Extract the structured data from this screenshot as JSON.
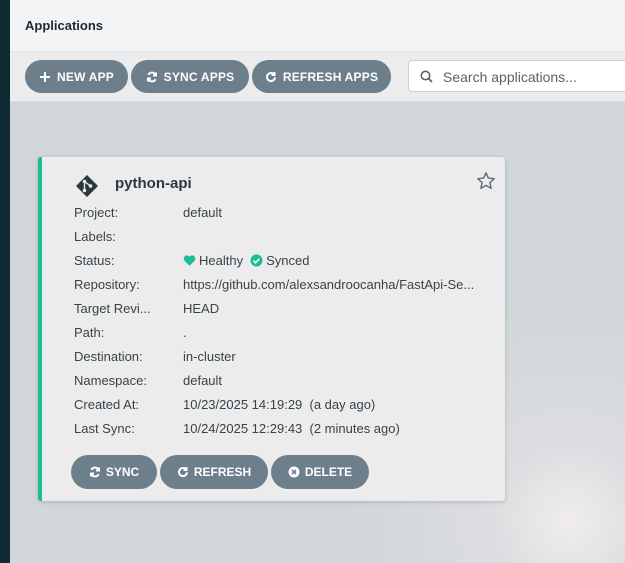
{
  "header": {
    "title": "Applications"
  },
  "toolbar": {
    "new_app": "NEW APP",
    "sync_apps": "SYNC APPS",
    "refresh_apps": "REFRESH APPS",
    "search_placeholder": "Search applications..."
  },
  "app": {
    "name": "python-api",
    "fields": [
      {
        "key": "Project:",
        "value": "default"
      },
      {
        "key": "Labels:",
        "value": ""
      },
      {
        "key": "Status:",
        "health": "Healthy",
        "sync": "Synced"
      },
      {
        "key": "Repository:",
        "value": "https://github.com/alexsandroocanha/FastApi-Se..."
      },
      {
        "key": "Target Revi...",
        "value": "HEAD"
      },
      {
        "key": "Path:",
        "value": "."
      },
      {
        "key": "Destination:",
        "value": "in-cluster"
      },
      {
        "key": "Namespace:",
        "value": "default"
      },
      {
        "key": "Created At:",
        "value": "10/23/2025 14:19:29  (a day ago)"
      },
      {
        "key": "Last Sync:",
        "value": "10/24/2025 12:29:43  (2 minutes ago)"
      }
    ],
    "buttons": {
      "sync": "SYNC",
      "refresh": "REFRESH",
      "delete": "DELETE"
    }
  },
  "colors": {
    "healthy": "#18be94",
    "accent": "#18be94",
    "button": "#6d7f8b",
    "sidebar": "#0f2a33"
  }
}
